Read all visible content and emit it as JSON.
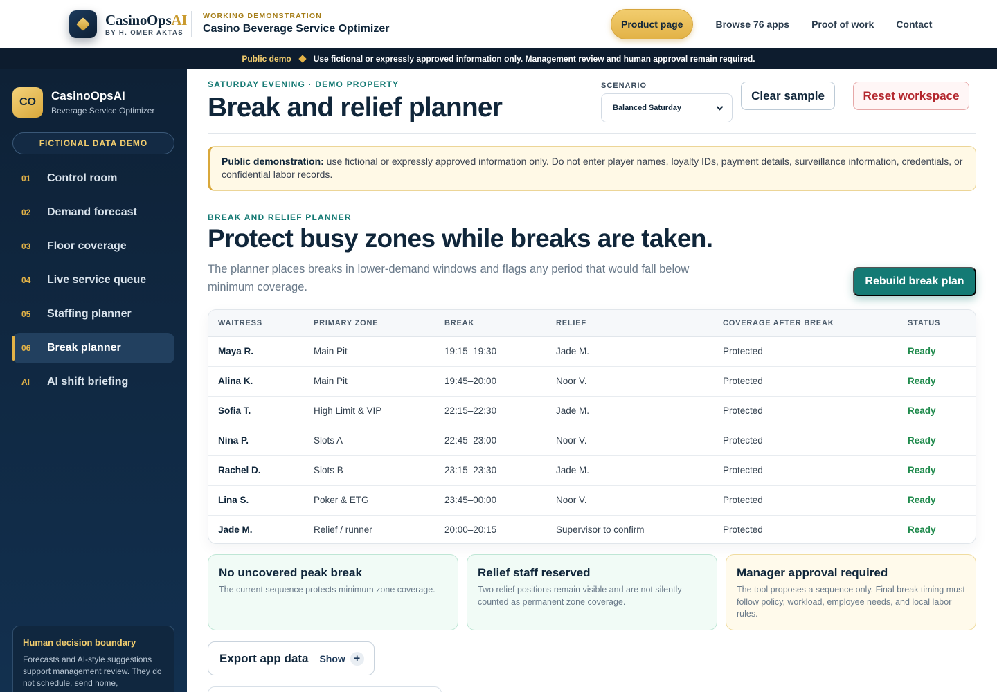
{
  "header": {
    "brand_name": "CasinoOps",
    "brand_ai": "AI",
    "brand_by": "BY H. OMER AKTAS",
    "app_kicker": "WORKING DEMONSTRATION",
    "app_title": "Casino Beverage Service Optimizer",
    "nav": {
      "primary": "Product page",
      "links": [
        "Browse 76 apps",
        "Proof of work",
        "Contact"
      ]
    }
  },
  "notice": {
    "tag": "Public demo",
    "text": "Use fictional or expressly approved information only. Management review and human approval remain required."
  },
  "sidebar": {
    "avatar": "CO",
    "brand_name": "CasinoOpsAI",
    "brand_sub": "Beverage Service Optimizer",
    "badge": "FICTIONAL DATA DEMO",
    "items": [
      {
        "num": "01",
        "label": "Control room"
      },
      {
        "num": "02",
        "label": "Demand forecast"
      },
      {
        "num": "03",
        "label": "Floor coverage"
      },
      {
        "num": "04",
        "label": "Live service queue"
      },
      {
        "num": "05",
        "label": "Staffing planner"
      },
      {
        "num": "06",
        "label": "Break planner"
      },
      {
        "num": "AI",
        "label": "AI shift briefing"
      }
    ],
    "active_index": 5,
    "box_title": "Human decision boundary",
    "box_text": "Forecasts and AI-style suggestions support management review. They do not schedule, send home,"
  },
  "page": {
    "kicker": "SATURDAY EVENING · DEMO PROPERTY",
    "title": "Break and relief planner",
    "scenario_label": "SCENARIO",
    "scenario_value": "Balanced Saturday",
    "clear_label": "Clear sample",
    "reset_label": "Reset workspace"
  },
  "alert": {
    "lead": "Public demonstration:",
    "text": " use fictional or expressly approved information only. Do not enter player names, loyalty IDs, payment details, surveillance information, credentials, or confidential labor records."
  },
  "section": {
    "kicker": "BREAK AND RELIEF PLANNER",
    "title": "Protect busy zones while breaks are taken.",
    "desc": "The planner places breaks in lower-demand windows and flags any period that would fall below minimum coverage.",
    "rebuild_label": "Rebuild break plan"
  },
  "table": {
    "headers": [
      "WAITRESS",
      "PRIMARY ZONE",
      "BREAK",
      "RELIEF",
      "COVERAGE AFTER BREAK",
      "STATUS"
    ],
    "rows": [
      [
        "Maya R.",
        "Main Pit",
        "19:15–19:30",
        "Jade M.",
        "Protected",
        "Ready"
      ],
      [
        "Alina K.",
        "Main Pit",
        "19:45–20:00",
        "Noor V.",
        "Protected",
        "Ready"
      ],
      [
        "Sofia T.",
        "High Limit & VIP",
        "22:15–22:30",
        "Jade M.",
        "Protected",
        "Ready"
      ],
      [
        "Nina P.",
        "Slots A",
        "22:45–23:00",
        "Noor V.",
        "Protected",
        "Ready"
      ],
      [
        "Rachel D.",
        "Slots B",
        "23:15–23:30",
        "Jade M.",
        "Protected",
        "Ready"
      ],
      [
        "Lina S.",
        "Poker & ETG",
        "23:45–00:00",
        "Noor V.",
        "Protected",
        "Ready"
      ],
      [
        "Jade M.",
        "Relief / runner",
        "20:00–20:15",
        "Supervisor to confirm",
        "Protected",
        "Ready"
      ]
    ]
  },
  "cards": [
    {
      "title": "No uncovered peak break",
      "text": "The current sequence protects minimum zone coverage.",
      "tone": "green"
    },
    {
      "title": "Relief staff reserved",
      "text": "Two relief positions remain visible and are not silently counted as permanent zone coverage.",
      "tone": "green"
    },
    {
      "title": "Manager approval required",
      "text": "The tool proposes a sequence only. Final break timing must follow policy, workload, employee needs, and local labor rules.",
      "tone": "amber"
    }
  ],
  "export": {
    "title": "Export app data",
    "toggle": "Show",
    "plus": "+"
  }
}
